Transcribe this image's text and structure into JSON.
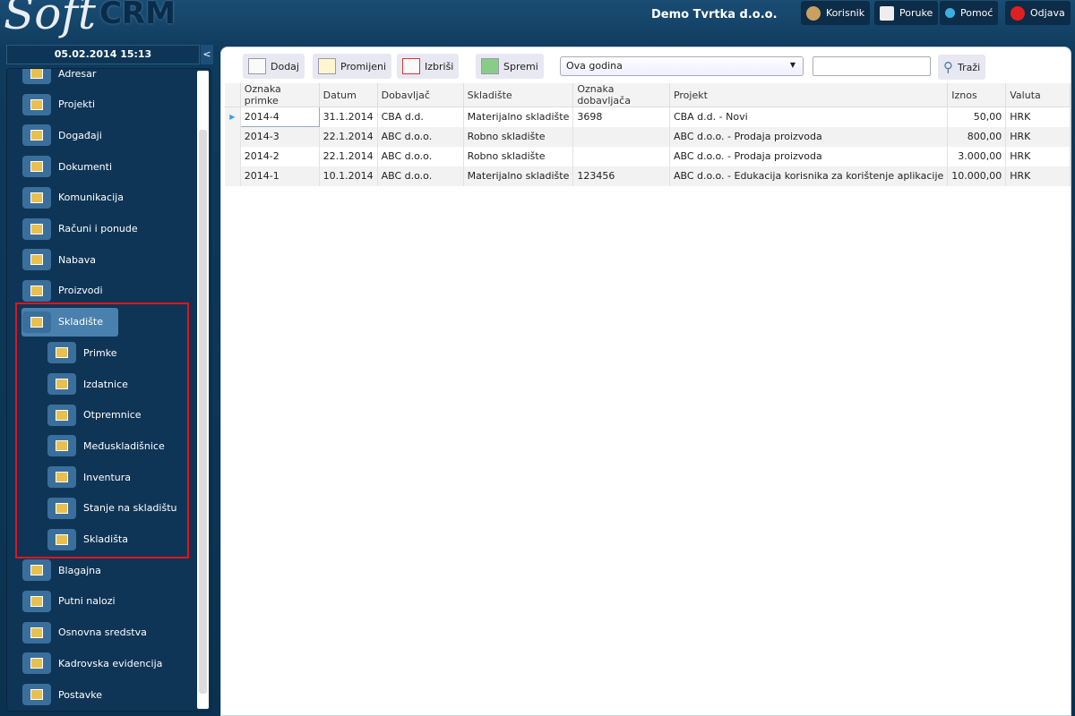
{
  "header": {
    "logo_left": "Soft",
    "logo_right": "CRM",
    "company": "Demo Tvrtka d.o.o.",
    "buttons": [
      {
        "label": "Korisnik",
        "icon": "user-icon"
      },
      {
        "label": "Poruke",
        "icon": "envelope-icon"
      },
      {
        "label": "Pomoć",
        "icon": "info-icon"
      },
      {
        "label": "Odjava",
        "icon": "power-icon"
      }
    ]
  },
  "sidebar": {
    "datetime": "05.02.2014 15:13",
    "collapse": "<",
    "items": [
      "Adresar",
      "Projekti",
      "Događaji",
      "Dokumenti",
      "Komunikacija",
      "Računi i ponude",
      "Nabava",
      "Proizvodi",
      "Skladište"
    ],
    "subitems": [
      "Primke",
      "Izdatnice",
      "Otpremnice",
      "Međuskladišnice",
      "Inventura",
      "Stanje na skladištu",
      "Skladišta"
    ],
    "items_after": [
      "Blagajna",
      "Putni nalozi",
      "Osnovna sredstva",
      "Kadrovska evidencija",
      "Postavke"
    ]
  },
  "toolbar": {
    "add": "Dodaj",
    "edit": "Promijeni",
    "delete": "Izbriši",
    "save": "Spremi",
    "period": "Ova godina",
    "search_value": "",
    "search": "Traži"
  },
  "table": {
    "columns": [
      "Oznaka primke",
      "Datum",
      "Dobavljač",
      "Skladište",
      "Oznaka dobavljača",
      "Projekt",
      "Iznos",
      "Valuta"
    ],
    "rows": [
      [
        "2014-4",
        "31.1.2014",
        "CBA d.d.",
        "Materijalno skladište",
        "3698",
        "CBA d.d. - Novi",
        "50,00",
        "HRK"
      ],
      [
        "2014-3",
        "22.1.2014",
        "ABC d.o.o.",
        "Robno skladište",
        "",
        "ABC d.o.o. - Prodaja proizvoda",
        "800,00",
        "HRK"
      ],
      [
        "2014-2",
        "22.1.2014",
        "ABC d.o.o.",
        "Robno skladište",
        "",
        "ABC d.o.o. - Prodaja proizvoda",
        "3.000,00",
        "HRK"
      ],
      [
        "2014-1",
        "10.1.2014",
        "ABC d.o.o.",
        "Materijalno skladište",
        "123456",
        "ABC d.o.o. - Edukacija korisnika za korištenje aplikacije",
        "10.000,00",
        "HRK"
      ]
    ]
  }
}
